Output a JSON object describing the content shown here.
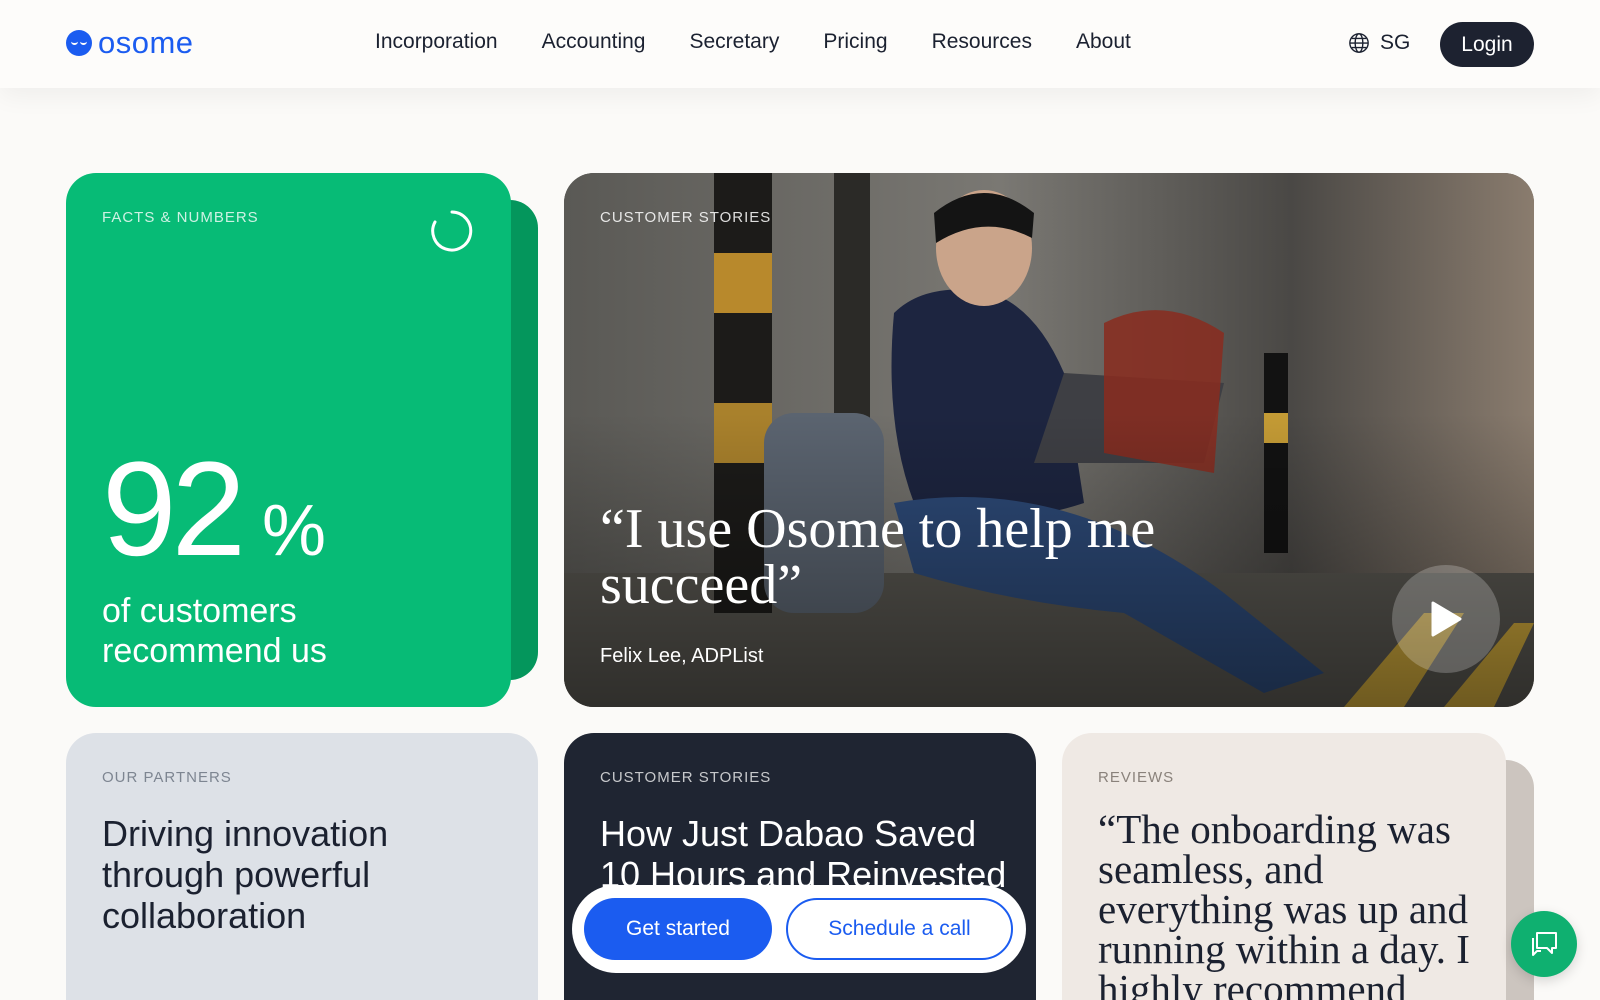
{
  "header": {
    "logo_text": "osome",
    "nav": [
      "Incorporation",
      "Accounting",
      "Secretary",
      "Pricing",
      "Resources",
      "About"
    ],
    "region": "SG",
    "login_label": "Login"
  },
  "facts": {
    "eyebrow": "FACTS & NUMBERS",
    "number": "92",
    "unit": "%",
    "caption": "of customers recommend us"
  },
  "video_story": {
    "eyebrow": "CUSTOMER STORIES",
    "quote": "“I use Osome to help me succeed”",
    "author": "Felix Lee, ADPList"
  },
  "partners": {
    "eyebrow": "OUR PARTNERS",
    "title": "Driving innovation through powerful collaboration"
  },
  "story2": {
    "eyebrow": "CUSTOMER STORIES",
    "title": "How Just Dabao Saved 10 Hours and Reinvested"
  },
  "review": {
    "eyebrow": "REVIEWS",
    "text": "“The onboarding was seamless, and everything was up and running within a day. I highly recommend"
  },
  "cta": {
    "primary_label": "Get started",
    "secondary_label": "Schedule a call"
  },
  "colors": {
    "brand_blue": "#1b5cf0",
    "facts_green": "#07bb76",
    "dark_navy": "#1f2532"
  }
}
